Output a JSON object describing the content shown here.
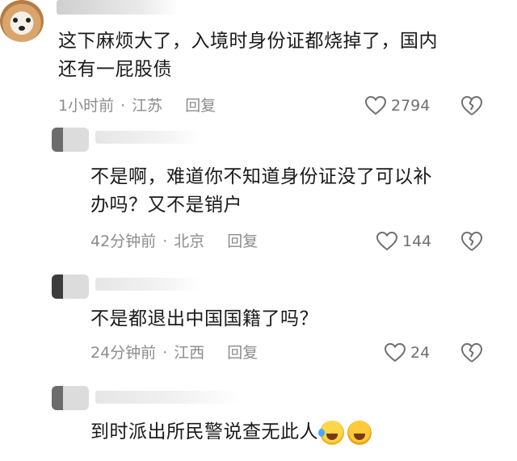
{
  "comments": [
    {
      "text_line1": "这下麻烦大了，入境时身份证都烧掉了，国内",
      "text_line2": "还有一屁股债",
      "time": "1小时前",
      "location": "江苏",
      "reply_label": "回复",
      "likes": "2794"
    },
    {
      "text_line1": "不是啊，难道你不知道身份证没了可以补",
      "text_line2": "办吗？又不是销户",
      "time": "42分钟前",
      "location": "北京",
      "reply_label": "回复",
      "likes": "144"
    },
    {
      "text_line1": "不是都退出中国国籍了吗？",
      "time": "24分钟前",
      "location": "江西",
      "reply_label": "回复",
      "likes": "24"
    },
    {
      "text_line1": "到时派出所民警说查无此人",
      "emojis": [
        "laughing-tears-emoji",
        "laughing-emoji"
      ]
    }
  ],
  "separator": "·",
  "colors": {
    "text": "#1a1a1a",
    "meta": "#8c8c8c",
    "icon": "#6f6f6f"
  }
}
